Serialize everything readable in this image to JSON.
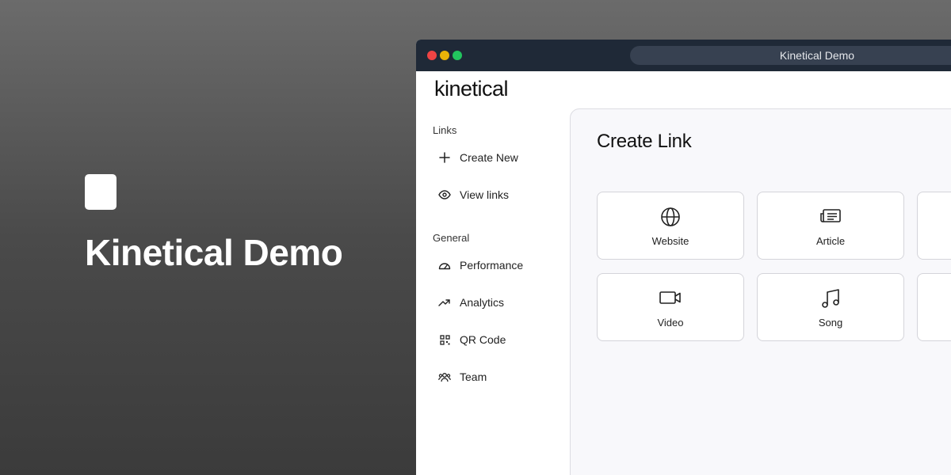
{
  "promo": {
    "title": "Kinetical Demo"
  },
  "window": {
    "address_bar": "Kinetical Demo"
  },
  "sidebar": {
    "logo": "kinetical",
    "sections": [
      {
        "label": "Links",
        "items": [
          {
            "label": "Create New",
            "icon": "plus-icon"
          },
          {
            "label": "View links",
            "icon": "eye-icon"
          }
        ]
      },
      {
        "label": "General",
        "items": [
          {
            "label": "Performance",
            "icon": "gauge-icon"
          },
          {
            "label": "Analytics",
            "icon": "trending-up-icon"
          },
          {
            "label": "QR Code",
            "icon": "qr-code-icon"
          },
          {
            "label": "Team",
            "icon": "team-icon"
          }
        ]
      }
    ]
  },
  "main": {
    "title": "Create Link",
    "cards": [
      {
        "label": "Website",
        "icon": "globe-icon"
      },
      {
        "label": "Article",
        "icon": "newspaper-icon"
      },
      {
        "label": "Video",
        "icon": "video-camera-icon"
      },
      {
        "label": "Song",
        "icon": "music-note-icon"
      }
    ]
  },
  "colors": {
    "titlebar": "#1f2937",
    "address_bar": "#374151",
    "traffic_red": "#ef4444",
    "traffic_yellow": "#eab308",
    "traffic_green": "#22c55e",
    "panel_background": "#f8f8fb"
  }
}
